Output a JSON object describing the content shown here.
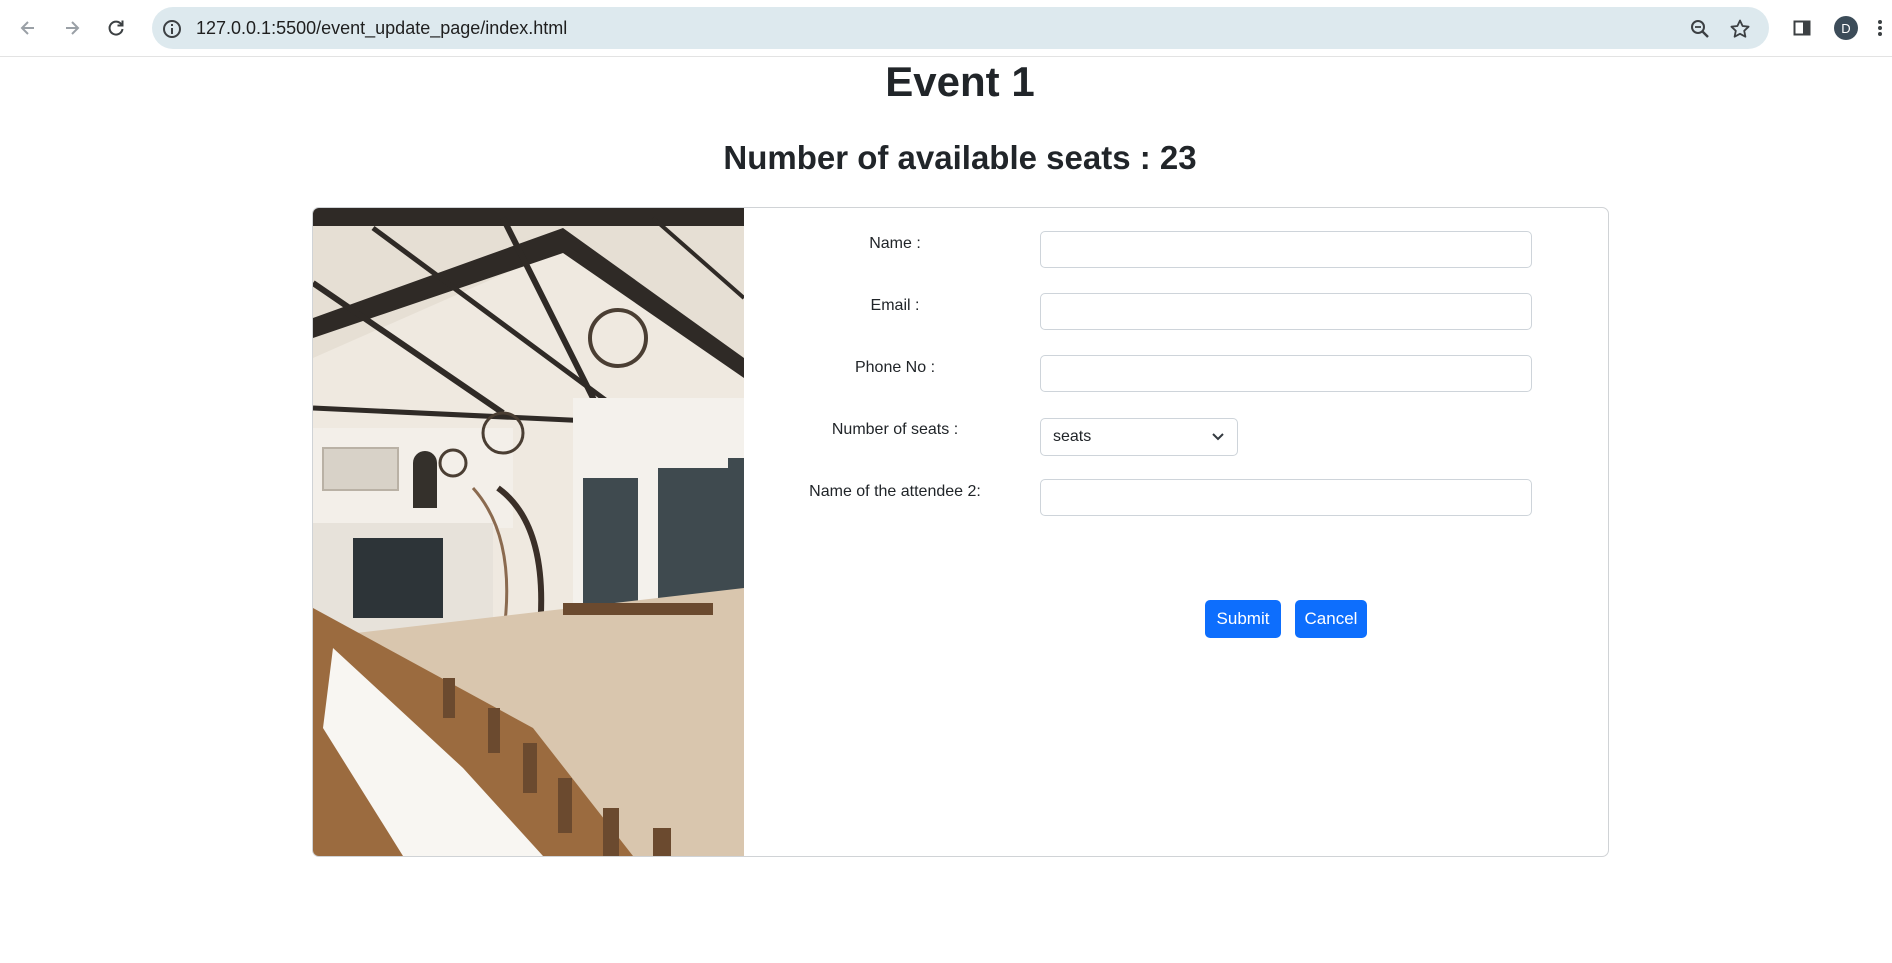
{
  "browser": {
    "url": "127.0.0.1:5500/event_update_page/index.html",
    "profile_initial": "D",
    "icons": [
      "back-arrow",
      "forward-arrow",
      "reload",
      "site-info",
      "zoom",
      "bookmark-star",
      "side-panel",
      "profile-avatar",
      "menu-dots"
    ]
  },
  "page": {
    "title": "Event 1",
    "seats_label": "Number of available seats : 23"
  },
  "form": {
    "name_label": "Name :",
    "email_label": "Email :",
    "phone_label": "Phone No :",
    "seats_label": "Number of seats :",
    "seats_select": "seats",
    "attendee_label": "Name of the attendee 2:",
    "submit_label": "Submit",
    "cancel_label": "Cancel"
  },
  "colors": {
    "primary": "#0d6efd",
    "omnibox": "#dde9ee"
  }
}
